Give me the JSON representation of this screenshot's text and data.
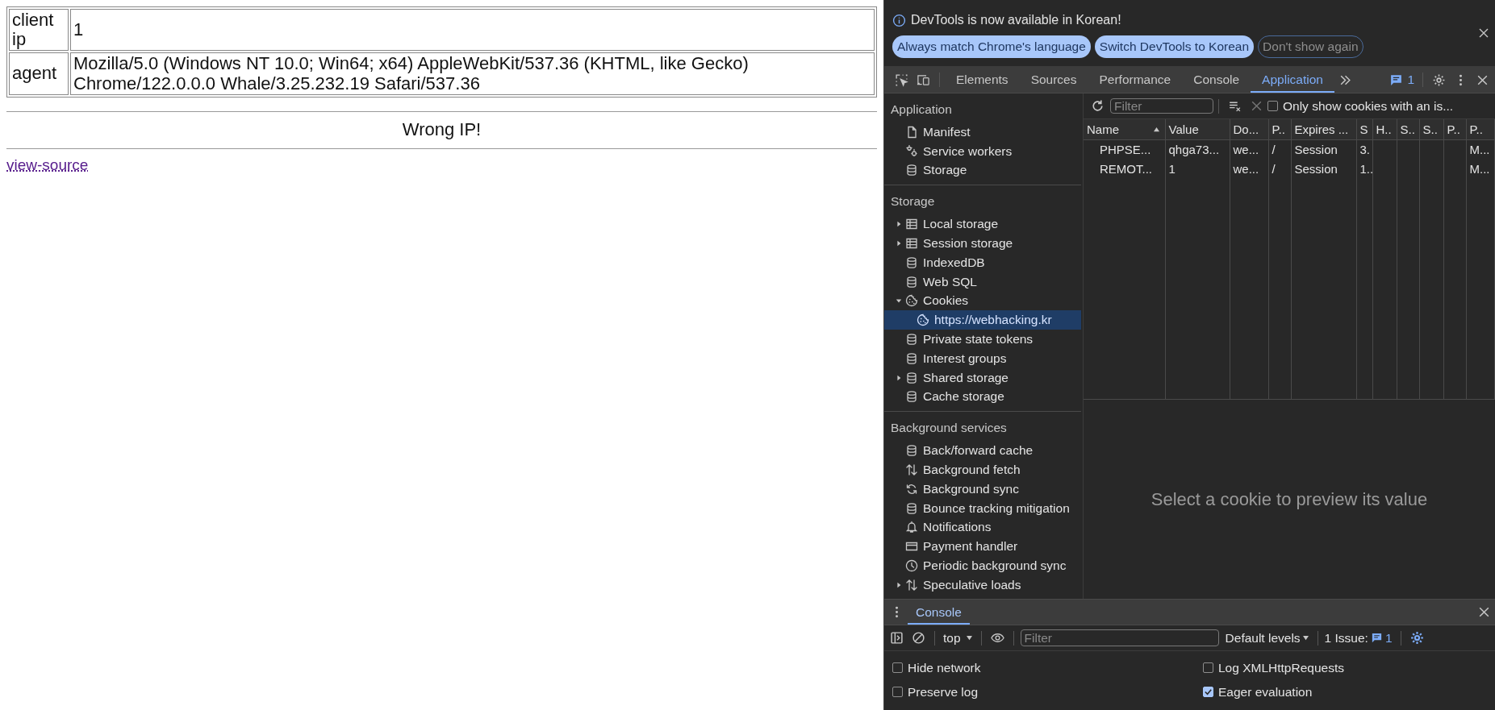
{
  "page": {
    "rows": [
      {
        "label": "client ip",
        "value": "1"
      },
      {
        "label": "agent",
        "value": "Mozilla/5.0 (Windows NT 10.0; Win64; x64) AppleWebKit/537.36 (KHTML, like Gecko) Chrome/122.0.0.0 Whale/3.25.232.19 Safari/537.36"
      }
    ],
    "message": "Wrong IP!",
    "link": "view-source"
  },
  "devtools": {
    "banner": {
      "text": "DevTools is now available in Korean!",
      "buttons": [
        {
          "label": "Always match Chrome's language",
          "kind": "filled"
        },
        {
          "label": "Switch DevTools to Korean",
          "kind": "filled"
        },
        {
          "label": "Don't show again",
          "kind": "outline"
        }
      ]
    },
    "tabs": [
      {
        "label": "Elements",
        "selected": false
      },
      {
        "label": "Sources",
        "selected": false
      },
      {
        "label": "Performance",
        "selected": false
      },
      {
        "label": "Console",
        "selected": false
      },
      {
        "label": "Application",
        "selected": true
      }
    ],
    "issues_count": "1",
    "sidebar": {
      "sections": [
        {
          "title": "Application",
          "items": [
            {
              "label": "Manifest",
              "kind": "file",
              "selected": false
            },
            {
              "label": "Service workers",
              "kind": "gears",
              "selected": false
            },
            {
              "label": "Storage",
              "kind": "database",
              "selected": false
            }
          ]
        },
        {
          "title": "Storage",
          "items": [
            {
              "label": "Local storage",
              "kind": "table",
              "expanded": false,
              "selected": false
            },
            {
              "label": "Session storage",
              "kind": "table",
              "expanded": false,
              "selected": false
            },
            {
              "label": "IndexedDB",
              "kind": "database",
              "selected": false
            },
            {
              "label": "Web SQL",
              "kind": "database",
              "selected": false
            },
            {
              "label": "Cookies",
              "kind": "cookie",
              "expanded": true,
              "selected": false,
              "children": [
                {
                  "label": "https://webhacking.kr",
                  "kind": "cookie",
                  "selected": true
                }
              ]
            },
            {
              "label": "Private state tokens",
              "kind": "database",
              "selected": false
            },
            {
              "label": "Interest groups",
              "kind": "database",
              "selected": false
            },
            {
              "label": "Shared storage",
              "kind": "database",
              "expanded": false,
              "selected": false
            },
            {
              "label": "Cache storage",
              "kind": "database",
              "selected": false
            }
          ]
        },
        {
          "title": "Background services",
          "items": [
            {
              "label": "Back/forward cache",
              "kind": "database",
              "selected": false
            },
            {
              "label": "Background fetch",
              "kind": "updown",
              "selected": false
            },
            {
              "label": "Background sync",
              "kind": "sync",
              "selected": false
            },
            {
              "label": "Bounce tracking mitigation",
              "kind": "database",
              "selected": false
            },
            {
              "label": "Notifications",
              "kind": "bell",
              "selected": false
            },
            {
              "label": "Payment handler",
              "kind": "card",
              "selected": false
            },
            {
              "label": "Periodic background sync",
              "kind": "clock",
              "selected": false
            },
            {
              "label": "Speculative loads",
              "kind": "updown",
              "expanded": false,
              "selected": false
            }
          ]
        }
      ]
    },
    "cookies": {
      "filter_placeholder": "Filter",
      "only_issues": {
        "label": "Only show cookies with an is...",
        "checked": false
      },
      "columns": [
        {
          "label": "Name",
          "sorted": true
        },
        {
          "label": "Value"
        },
        {
          "label": "Do..."
        },
        {
          "label": "P.."
        },
        {
          "label": "Expires ..."
        },
        {
          "label": "S"
        },
        {
          "label": "H.."
        },
        {
          "label": "S.."
        },
        {
          "label": "S.."
        },
        {
          "label": "P.."
        },
        {
          "label": "P.."
        }
      ],
      "rows": [
        [
          "PHPSE...",
          "qhga73...",
          "we...",
          "/",
          "Session",
          "3.",
          null,
          null,
          null,
          null,
          "M..."
        ],
        [
          "REMOT...",
          "1",
          "we...",
          "/",
          "Session",
          "1..",
          null,
          null,
          null,
          null,
          "M..."
        ]
      ],
      "preview": "Select a cookie to preview its value"
    },
    "drawer": {
      "tabs": [
        {
          "label": "Console",
          "selected": true
        }
      ],
      "context": "top",
      "filter_placeholder": "Filter",
      "levels": "Default levels",
      "issues_label": "1 Issue:",
      "issues_count": "1",
      "settings": [
        {
          "label": "Hide network",
          "checked": false
        },
        {
          "label": "Log XMLHttpRequests",
          "checked": false
        },
        {
          "label": "Preserve log",
          "checked": false
        },
        {
          "label": "Eager evaluation",
          "checked": true
        }
      ]
    }
  }
}
